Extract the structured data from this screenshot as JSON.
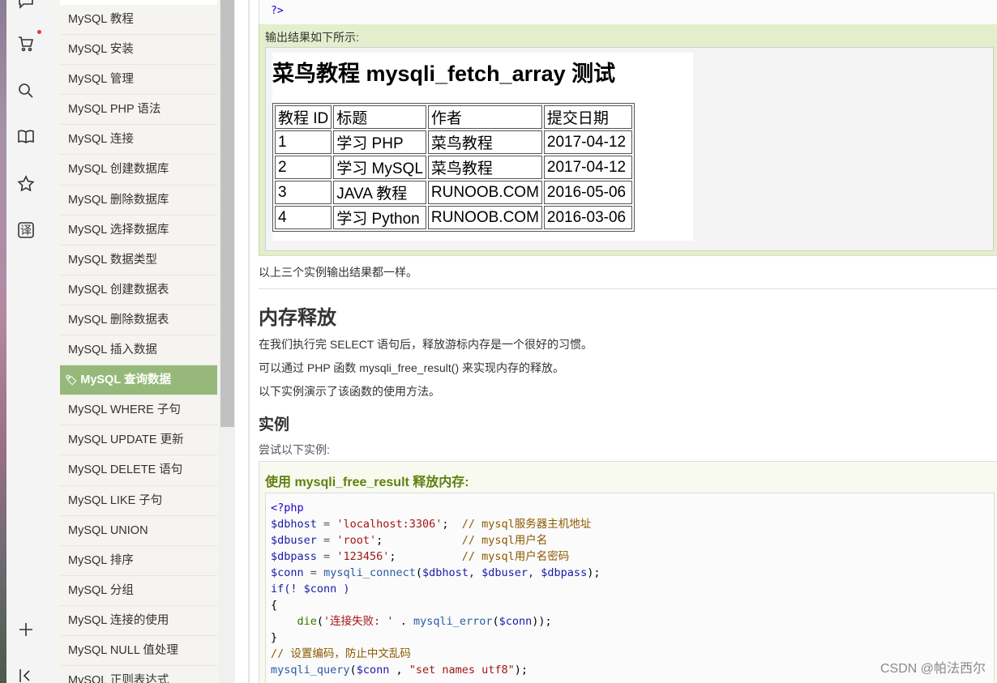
{
  "rail": {
    "icons": [
      "chat-icon",
      "cart-icon",
      "search-icon",
      "book-icon",
      "star-icon",
      "translate-icon",
      "add-icon",
      "collapse-icon"
    ],
    "translate_glyph": "译"
  },
  "sidebar": {
    "items": [
      {
        "label": "MySQL 教程"
      },
      {
        "label": "MySQL 安装"
      },
      {
        "label": "MySQL 管理"
      },
      {
        "label": "MySQL PHP 语法"
      },
      {
        "label": "MySQL 连接"
      },
      {
        "label": "MySQL 创建数据库"
      },
      {
        "label": "MySQL 删除数据库"
      },
      {
        "label": "MySQL 选择数据库"
      },
      {
        "label": "MySQL 数据类型"
      },
      {
        "label": "MySQL 创建数据表"
      },
      {
        "label": "MySQL 删除数据表"
      },
      {
        "label": "MySQL 插入数据"
      },
      {
        "label": "MySQL 查询数据",
        "active": true
      },
      {
        "label": "MySQL WHERE 子句"
      },
      {
        "label": "MySQL UPDATE 更新"
      },
      {
        "label": "MySQL DELETE 语句"
      },
      {
        "label": "MySQL LIKE 子句"
      },
      {
        "label": "MySQL UNION"
      },
      {
        "label": "MySQL 排序"
      },
      {
        "label": "MySQL 分组"
      },
      {
        "label": "MySQL 连接的使用"
      },
      {
        "label": "MySQL NULL 值处理"
      },
      {
        "label": "MySQL 正则表达式"
      }
    ]
  },
  "main": {
    "code_top_end": "?>",
    "output_label": "输出结果如下所示:",
    "result": {
      "title": "菜鸟教程 mysqli_fetch_array 测试",
      "headers": [
        "教程 ID",
        "标题",
        "作者",
        "提交日期"
      ],
      "rows": [
        [
          "1",
          "学习 PHP",
          "菜鸟教程",
          "2017-04-12"
        ],
        [
          "2",
          "学习 MySQL",
          "菜鸟教程",
          "2017-04-12"
        ],
        [
          "3",
          "JAVA 教程",
          "RUNOOB.COM",
          "2016-05-06"
        ],
        [
          "4",
          "学习 Python",
          "RUNOOB.COM",
          "2016-03-06"
        ]
      ]
    },
    "same_output_note": "以上三个实例输出结果都一样。",
    "section_heading": "内存释放",
    "para1": "在我们执行完 SELECT 语句后，释放游标内存是一个很好的习惯。",
    "para2": "可以通过 PHP 函数 mysqli_free_result() 来实现内存的释放。",
    "para3": "以下实例演示了该函数的使用方法。",
    "example_heading": "实例",
    "try_label": "尝试以下实例:",
    "example_title": "使用 mysqli_free_result 释放内存:",
    "code": {
      "l1": "<?php",
      "l2_var": "$dbhost",
      "l2_str": "'localhost:3306'",
      "l2_cmt": "// mysql服务器主机地址",
      "l3_var": "$dbuser",
      "l3_str": "'root'",
      "l3_cmt": "// mysql用户名",
      "l4_var": "$dbpass",
      "l4_str": "'123456'",
      "l4_cmt": "// mysql用户名密码",
      "l5_var": "$conn",
      "l5_fn": "mysqli_connect",
      "l5_args": "$dbhost, $dbuser, $dbpass",
      "l6": "if(! $conn )",
      "l7": "{",
      "l8_die": "die",
      "l8_str": "'连接失败: '",
      "l8_fn": "mysqli_error",
      "l8_arg": "$conn",
      "l9": "}",
      "l10_cmt": "// 设置编码，防止中文乱码",
      "l11_fn": "mysqli_query",
      "l11_arg": "$conn",
      "l11_str": "\"set names utf8\""
    }
  },
  "watermark": "CSDN @帕法西尔"
}
